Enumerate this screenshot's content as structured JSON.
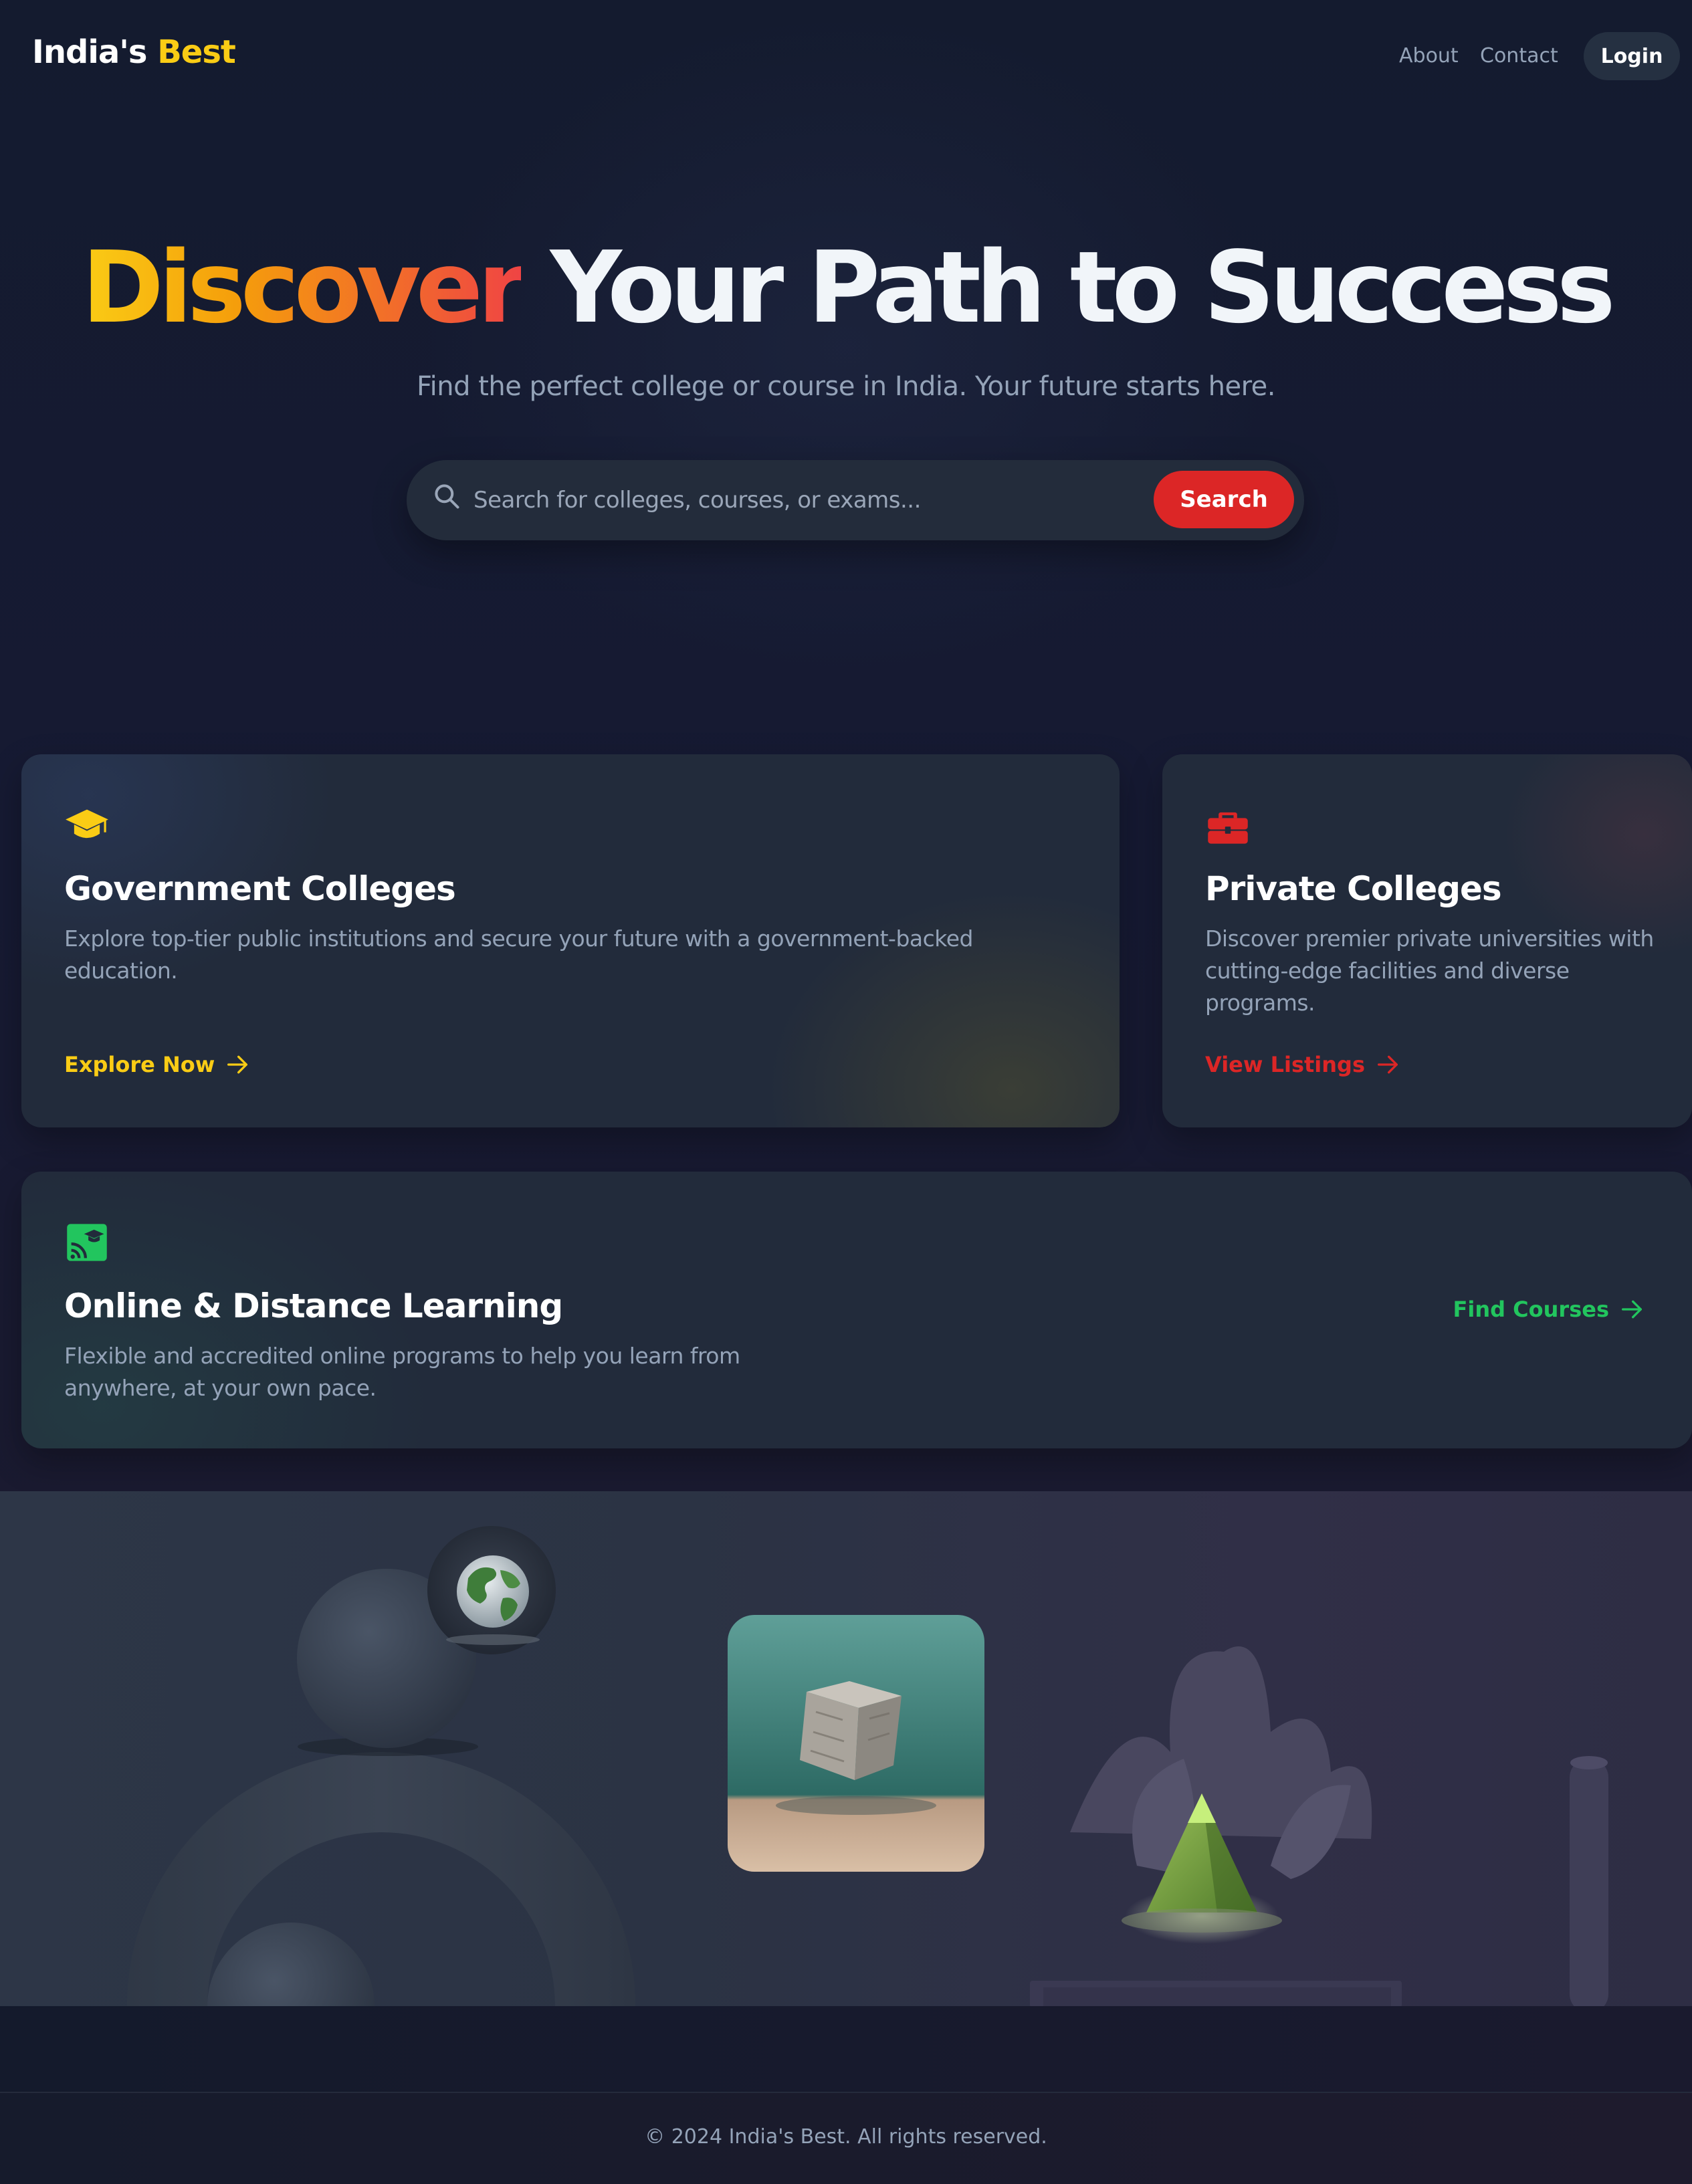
{
  "nav": {
    "logo_main": "India's ",
    "logo_accent": "Best",
    "links": [
      "About",
      "Contact"
    ],
    "login_label": "Login"
  },
  "hero": {
    "title_highlight": "Discover",
    "title_rest": " Your Path to Success",
    "subtitle": "Find the perfect college or course in India. Your future starts here.",
    "search_placeholder": "Search for colleges, courses, or exams...",
    "search_button": "Search"
  },
  "cards": [
    {
      "icon": "graduation-cap-icon",
      "title": "Government Colleges",
      "description": "Explore top-tier public institutions and secure your future with a government-backed education.",
      "link": "Explore Now",
      "accent": "#facc15"
    },
    {
      "icon": "briefcase-icon",
      "title": "Private Colleges",
      "description": "Discover premier private universities with cutting-edge facilities and diverse programs.",
      "link": "View Listings",
      "accent": "#dc2626"
    },
    {
      "icon": "online-learning-icon",
      "title": "Online & Distance Learning",
      "description": "Flexible and accredited online programs to help you learn from anywhere, at your own pace.",
      "link": "Find Courses",
      "accent": "#22c55e"
    }
  ],
  "footer": {
    "copyright": "© 2024 India's Best. All rights reserved."
  },
  "colors": {
    "background": "#151a2e",
    "card": "#222b3b",
    "yellow": "#facc15",
    "red": "#dc2626",
    "green": "#22c55e",
    "muted_text": "#94a3b8"
  }
}
